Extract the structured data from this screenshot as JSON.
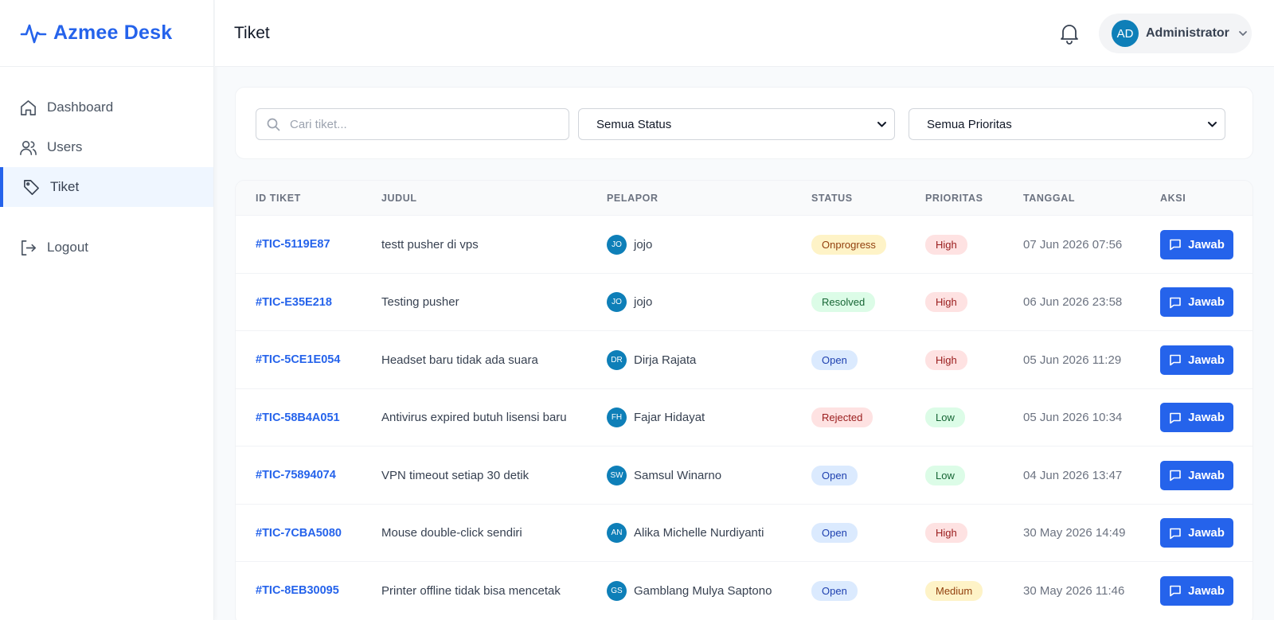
{
  "brand": {
    "name": "Azmee Desk",
    "color": "#2563eb"
  },
  "sidebar": {
    "items": [
      {
        "label": "Dashboard",
        "icon": "home-icon",
        "active": false
      },
      {
        "label": "Users",
        "icon": "users-icon",
        "active": false
      },
      {
        "label": "Tiket",
        "icon": "tag-icon",
        "active": true
      }
    ],
    "logout_label": "Logout"
  },
  "header": {
    "title": "Tiket",
    "user": {
      "initials": "AD",
      "name": "Administrator"
    }
  },
  "filters": {
    "search_placeholder": "Cari tiket...",
    "status_value": "Semua Status",
    "priority_value": "Semua Prioritas"
  },
  "table": {
    "columns": [
      "ID TIKET",
      "JUDUL",
      "PELAPOR",
      "STATUS",
      "PRIORITAS",
      "TANGGAL",
      "AKSI"
    ],
    "action_label": "Jawab",
    "rows": [
      {
        "id": "#TIC-5119E87",
        "title": "testt pusher di vps",
        "initials": "JO",
        "reporter": "jojo",
        "status": "Onprogress",
        "priority": "High",
        "date": "07 Jun 2026 07:56"
      },
      {
        "id": "#TIC-E35E218",
        "title": "Testing pusher",
        "initials": "JO",
        "reporter": "jojo",
        "status": "Resolved",
        "priority": "High",
        "date": "06 Jun 2026 23:58"
      },
      {
        "id": "#TIC-5CE1E054",
        "title": "Headset baru tidak ada suara",
        "initials": "DR",
        "reporter": "Dirja Rajata",
        "status": "Open",
        "priority": "High",
        "date": "05 Jun 2026 11:29"
      },
      {
        "id": "#TIC-58B4A051",
        "title": "Antivirus expired butuh lisensi baru",
        "initials": "FH",
        "reporter": "Fajar Hidayat",
        "status": "Rejected",
        "priority": "Low",
        "date": "05 Jun 2026 10:34"
      },
      {
        "id": "#TIC-75894074",
        "title": "VPN timeout setiap 30 detik",
        "initials": "SW",
        "reporter": "Samsul Winarno",
        "status": "Open",
        "priority": "Low",
        "date": "04 Jun 2026 13:47"
      },
      {
        "id": "#TIC-7CBA5080",
        "title": "Mouse double-click sendiri",
        "initials": "AN",
        "reporter": "Alika Michelle Nurdiyanti",
        "status": "Open",
        "priority": "High",
        "date": "30 May 2026 14:49"
      },
      {
        "id": "#TIC-8EB30095",
        "title": "Printer offline tidak bisa mencetak",
        "initials": "GS",
        "reporter": "Gamblang Mulya Saptono",
        "status": "Open",
        "priority": "Medium",
        "date": "30 May 2026 11:46"
      }
    ]
  },
  "badge_colors": {
    "Onprogress": {
      "bg": "#fef3c7",
      "fg": "#92400e"
    },
    "Resolved": {
      "bg": "#dcfce7",
      "fg": "#166534"
    },
    "Open": {
      "bg": "#dbeafe",
      "fg": "#1e40af"
    },
    "Rejected": {
      "bg": "#fee2e2",
      "fg": "#991b1b"
    },
    "High": {
      "bg": "#fee2e2",
      "fg": "#991b1b"
    },
    "Low": {
      "bg": "#dcfce7",
      "fg": "#166534"
    },
    "Medium": {
      "bg": "#fef3c7",
      "fg": "#92400e"
    }
  }
}
